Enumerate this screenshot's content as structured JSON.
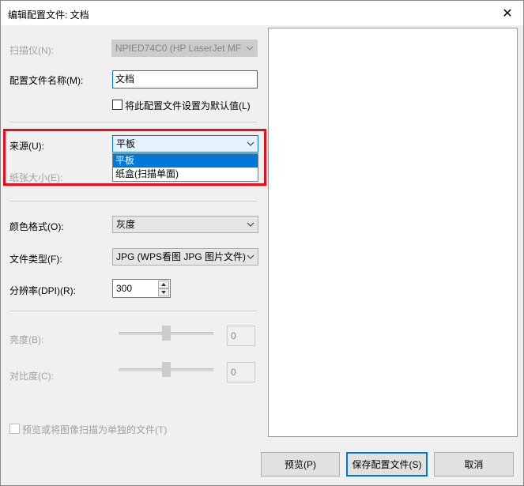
{
  "window": {
    "title": "编辑配置文件: 文档",
    "close_glyph": "✕"
  },
  "scanner": {
    "label": "扫描仪(N):",
    "value": "NPIED74C0 (HP LaserJet MF"
  },
  "profile_name": {
    "label": "配置文件名称(M):",
    "value": "文档"
  },
  "default_checkbox": {
    "label": "将此配置文件设置为默认值(L)"
  },
  "source": {
    "label": "来源(U):",
    "value": "平板",
    "options": [
      "平板",
      "纸盒(扫描单面)"
    ]
  },
  "paper_size": {
    "label": "纸张大小(E):"
  },
  "color_format": {
    "label": "颜色格式(O):",
    "value": "灰度"
  },
  "file_type": {
    "label": "文件类型(F):",
    "value": "JPG (WPS看图 JPG 图片文件)"
  },
  "resolution": {
    "label": "分辨率(DPI)(R):",
    "value": "300"
  },
  "brightness": {
    "label": "亮度(B):",
    "value": "0",
    "level": 0
  },
  "contrast": {
    "label": "对比度(C):",
    "value": "0",
    "level": 0
  },
  "separate_files_checkbox": {
    "label": "预览或将图像扫描为单独的文件(T)"
  },
  "buttons": {
    "preview": "预览(P)",
    "save": "保存配置文件(S)",
    "cancel": "取消"
  },
  "colors": {
    "accent": "#0078d7",
    "highlight_box": "#e3101c"
  }
}
